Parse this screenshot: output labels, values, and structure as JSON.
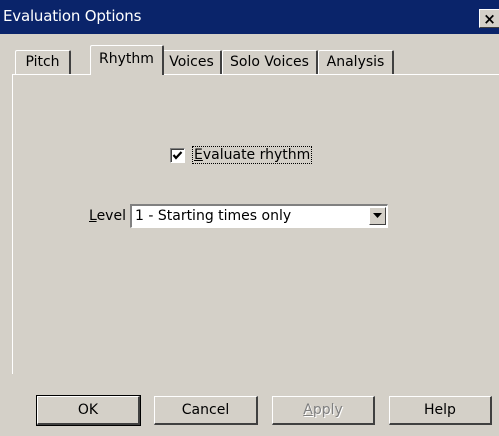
{
  "window": {
    "title": "Evaluation Options",
    "close_glyph": "×"
  },
  "tabs": [
    {
      "label": "Pitch",
      "active": false
    },
    {
      "label": "Rhythm",
      "active": true
    },
    {
      "label": "Voices",
      "active": false
    },
    {
      "label": "Solo Voices",
      "active": false
    },
    {
      "label": "Analysis",
      "active": false
    }
  ],
  "rhythm": {
    "evaluate_checkbox": {
      "label_mnemonic": "E",
      "label_rest": "valuate rhythm",
      "checked": true
    },
    "level": {
      "label_mnemonic": "L",
      "label_rest": "evel",
      "selected": "1 - Starting times only"
    }
  },
  "buttons": {
    "ok": "OK",
    "cancel": "Cancel",
    "apply_mnemonic": "A",
    "apply_rest": "pply",
    "help": "Help"
  },
  "colors": {
    "titlebar": "#0a246a",
    "face": "#d4d0c8"
  }
}
